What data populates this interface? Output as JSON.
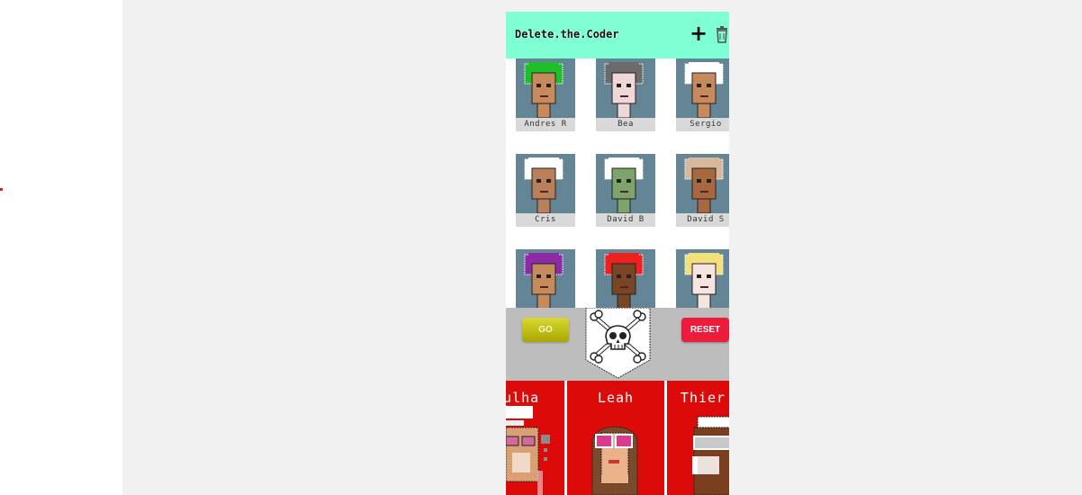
{
  "app": {
    "title": "Delete.the.Coder",
    "add_icon": "plus-icon",
    "add_symbol": "+",
    "trash_icon": "trash-icon"
  },
  "grid": {
    "cards": [
      {
        "name": "Andres R",
        "hair": "#1fbf2a",
        "skin": "#c68a5c"
      },
      {
        "name": "Bea",
        "hair": "#6b6b6b",
        "skin": "#f0d7d7"
      },
      {
        "name": "Sergio",
        "hair": "#ffffff",
        "skin": "#c68a5c"
      },
      {
        "name": "Cris",
        "hair": "#ffffff",
        "skin": "#b9805a"
      },
      {
        "name": "David B",
        "hair": "#ffffff",
        "skin": "#7ea36b"
      },
      {
        "name": "David S",
        "hair": "#d7b89a",
        "skin": "#a8683f"
      },
      {
        "name": "",
        "hair": "#8e2aa8",
        "skin": "#c68a5c"
      },
      {
        "name": "",
        "hair": "#ee2020",
        "skin": "#7a4525"
      },
      {
        "name": "",
        "hair": "#f3e07a",
        "skin": "#f5e4e0"
      }
    ]
  },
  "controls": {
    "go_label": "GO",
    "reset_label": "RESET",
    "skull_icon": "skull-crossbones-icon"
  },
  "strip": {
    "cards": [
      {
        "name": "dulha"
      },
      {
        "name": "Leah"
      },
      {
        "name": "Thier"
      }
    ]
  },
  "colors": {
    "appbar": "#7fffd4",
    "card_bg": "#638596",
    "strip_bg": "#dd0a0a",
    "go": "#c6c61a",
    "reset": "#ee1c3b"
  }
}
